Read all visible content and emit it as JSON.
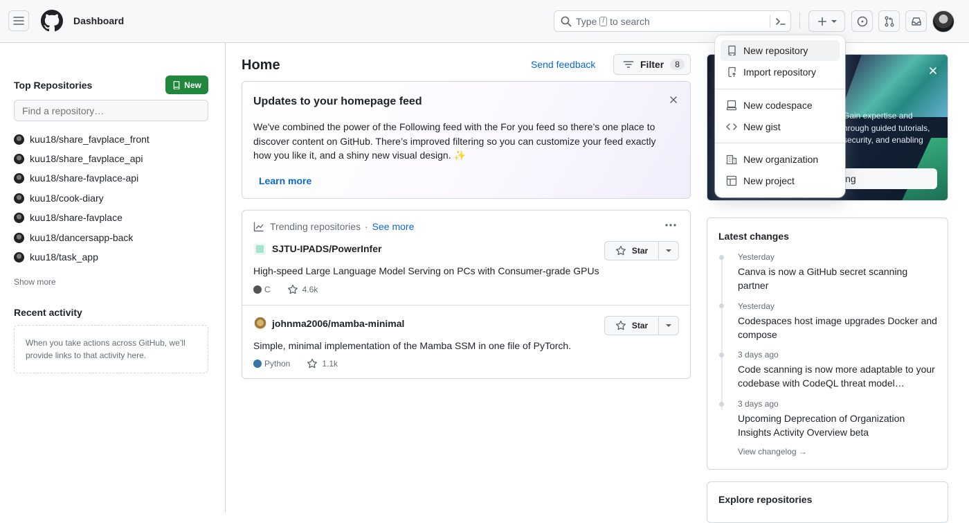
{
  "header": {
    "title": "Dashboard",
    "search_prefix": "Type",
    "search_key": "/",
    "search_suffix": "to search"
  },
  "sidebar": {
    "top_repos_title": "Top Repositories",
    "new_label": "New",
    "find_placeholder": "Find a repository…",
    "repos": [
      "kuu18/share_favplace_front",
      "kuu18/share_favplace_api",
      "kuu18/share-favplace-api",
      "kuu18/cook-diary",
      "kuu18/share-favplace",
      "kuu18/dancersapp-back",
      "kuu18/task_app"
    ],
    "show_more": "Show more",
    "recent_title": "Recent activity",
    "recent_text": "When you take actions across GitHub, we’ll provide links to that activity here."
  },
  "main": {
    "title": "Home",
    "send_feedback": "Send feedback",
    "filter_label": "Filter",
    "filter_count": "8",
    "updates": {
      "title": "Updates to your homepage feed",
      "body": "We've combined the power of the Following feed with the For you feed so there’s one place to discover content on GitHub. There’s improved filtering so you can customize your feed exactly how you like it, and a shiny new visual design. ✨",
      "learn_more": "Learn more"
    },
    "trending": {
      "label": "Trending repositories",
      "sep": "·",
      "see_more": "See more",
      "repos": [
        {
          "name": "SJTU-IPADS/PowerInfer",
          "desc": "High-speed Large Language Model Serving on PCs with Consumer-grade GPUs",
          "lang": "C",
          "lang_color": "#555555",
          "stars": "4.6k",
          "star_label": "Star"
        },
        {
          "name": "johnma2006/mamba-minimal",
          "desc": "Simple, minimal implementation of the Mamba SSM in one file of PyTorch.",
          "lang": "Python",
          "lang_color": "#3572A5",
          "stars": "1.1k",
          "star_label": "Star"
        }
      ]
    }
  },
  "promo": {
    "text_lines": [
      "Gain expertise and",
      "hrough guided tutorials,",
      "security, and enabling"
    ],
    "button_fragment": "ing"
  },
  "changes": {
    "title": "Latest changes",
    "items": [
      {
        "date": "Yesterday",
        "title": "Canva is now a GitHub secret scanning partner"
      },
      {
        "date": "Yesterday",
        "title": "Codespaces host image upgrades Docker and compose"
      },
      {
        "date": "3 days ago",
        "title": "Code scanning is now more adaptable to your codebase with CodeQL threat model…"
      },
      {
        "date": "3 days ago",
        "title": "Upcoming Deprecation of Organization Insights Activity Overview beta"
      }
    ],
    "view_changelog": "View changelog →"
  },
  "explore": {
    "title": "Explore repositories"
  },
  "create_menu": {
    "items": [
      {
        "label": "New repository",
        "icon": "repo-icon"
      },
      {
        "label": "Import repository",
        "icon": "repo-push-icon"
      },
      {
        "label": "New codespace",
        "icon": "codespaces-icon"
      },
      {
        "label": "New gist",
        "icon": "code-icon"
      },
      {
        "label": "New organization",
        "icon": "organization-icon"
      },
      {
        "label": "New project",
        "icon": "table-icon"
      }
    ]
  },
  "colors": {
    "accent": "#0969da",
    "success": "#1f883d",
    "border": "#d0d7de"
  }
}
